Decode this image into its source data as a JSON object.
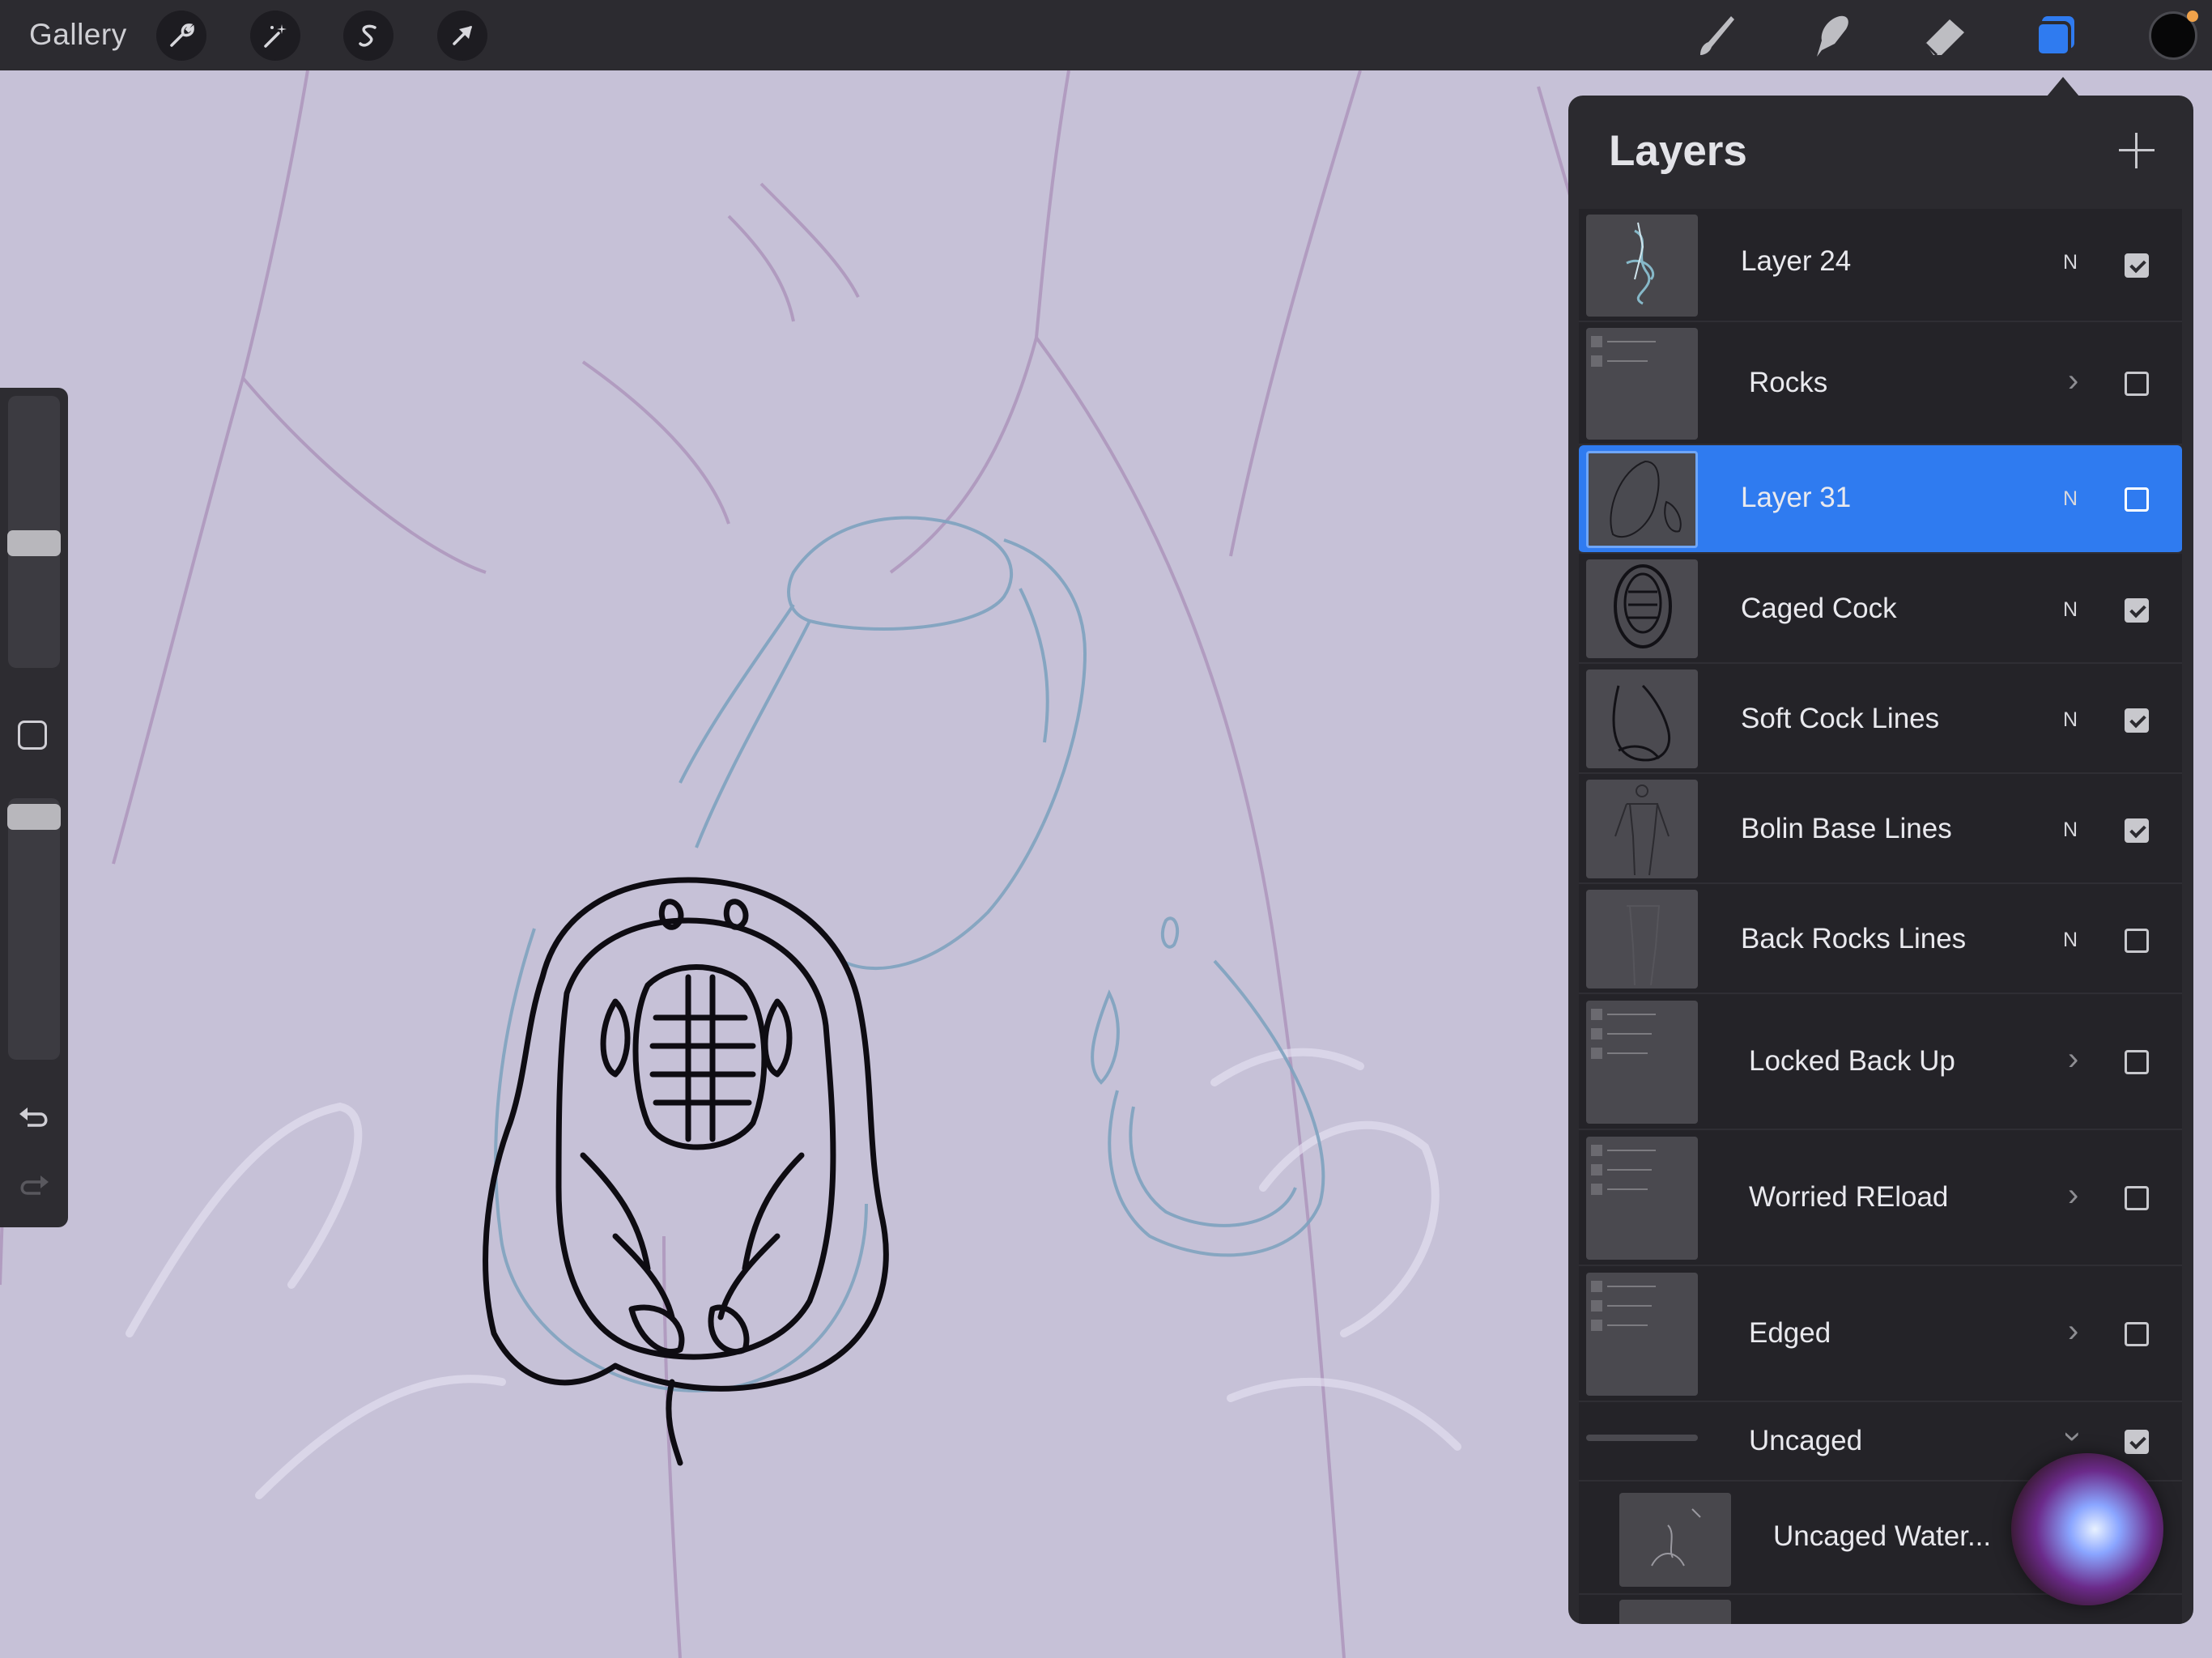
{
  "topbar": {
    "gallery_label": "Gallery",
    "left_tools": [
      "wrench-icon",
      "magic-wand-icon",
      "selection-s-icon",
      "arrow-transform-icon"
    ],
    "right_tools": [
      "brush-icon",
      "smudge-icon",
      "eraser-icon",
      "layers-icon"
    ],
    "active_tool": "layers-icon",
    "current_color": "#070708",
    "accent": "#2f7bf0"
  },
  "sidebar": {
    "brush_size_level": 0.45,
    "opacity_level": 0.95,
    "icons": [
      "modify-square-icon",
      "undo-icon",
      "redo-icon"
    ]
  },
  "panel": {
    "title": "Layers",
    "add_icon": "plus-icon",
    "layers": [
      {
        "name": "Layer 24",
        "mode": "N",
        "visible": true,
        "group": false,
        "selected": false
      },
      {
        "name": "Rocks",
        "mode": "",
        "visible": false,
        "group": true,
        "selected": false
      },
      {
        "name": "Layer 31",
        "mode": "N",
        "visible": false,
        "group": false,
        "selected": true
      },
      {
        "name": "Caged Cock",
        "mode": "N",
        "visible": true,
        "group": false,
        "selected": false
      },
      {
        "name": "Soft Cock Lines",
        "mode": "N",
        "visible": true,
        "group": false,
        "selected": false
      },
      {
        "name": "Bolin Base Lines",
        "mode": "N",
        "visible": true,
        "group": false,
        "selected": false
      },
      {
        "name": "Back Rocks Lines",
        "mode": "N",
        "visible": false,
        "group": false,
        "selected": false
      },
      {
        "name": "Locked Back Up",
        "mode": "",
        "visible": false,
        "group": true,
        "selected": false
      },
      {
        "name": "Worried REload",
        "mode": "",
        "visible": false,
        "group": true,
        "selected": false
      },
      {
        "name": "Edged",
        "mode": "",
        "visible": false,
        "group": true,
        "selected": false
      },
      {
        "name": "Uncaged",
        "mode": "",
        "visible": true,
        "group": true,
        "selected": false,
        "expanded": true
      },
      {
        "name": "Uncaged Water...",
        "mode": "",
        "visible": false,
        "group": false,
        "selected": false,
        "child": true
      }
    ]
  },
  "overlay": {
    "siri_icon": "siri-orb-icon"
  }
}
